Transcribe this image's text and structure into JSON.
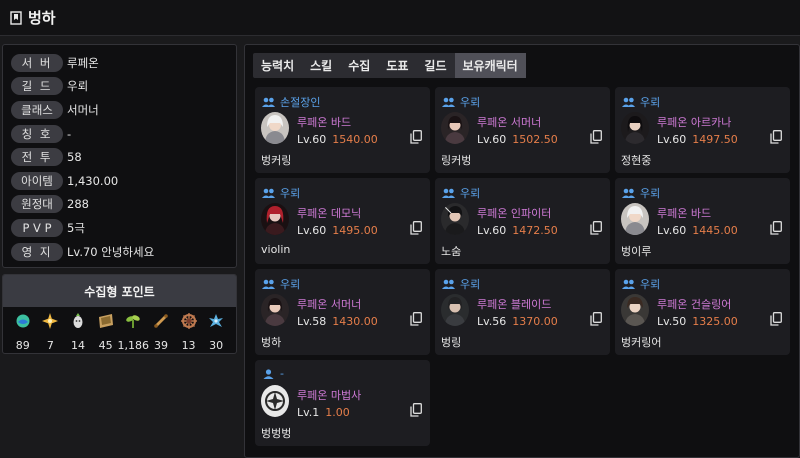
{
  "header": {
    "title": "벙하"
  },
  "info": {
    "rows": [
      {
        "label": "서 버",
        "value": "루페온"
      },
      {
        "label": "길 드",
        "value": "우뢰"
      },
      {
        "label": "클래스",
        "value": "서머너"
      },
      {
        "label": "칭 호",
        "value": "-"
      },
      {
        "label": "전 투",
        "value": "58"
      },
      {
        "label": "아이템",
        "value": "1,430.00"
      },
      {
        "label": "원정대",
        "value": "288"
      },
      {
        "label": "P V P",
        "value": "5극"
      },
      {
        "label": "영 지",
        "value": "Lv.70 안녕하세요"
      }
    ]
  },
  "collection": {
    "title": "수집형 포인트",
    "items": [
      {
        "icon": "island-heart-icon",
        "value": "89"
      },
      {
        "icon": "star-icon",
        "value": "7"
      },
      {
        "icon": "mokoko-seed-icon",
        "value": "14"
      },
      {
        "icon": "painting-icon",
        "value": "45"
      },
      {
        "icon": "sprout-icon",
        "value": "1,186"
      },
      {
        "icon": "adventure-scroll-icon",
        "value": "39"
      },
      {
        "icon": "great-voyage-icon",
        "value": "13"
      },
      {
        "icon": "world-tree-leaf-icon",
        "value": "30"
      }
    ]
  },
  "tabs": [
    "능력치",
    "스킬",
    "수집",
    "도표",
    "길드",
    "보유캐릭터"
  ],
  "active_tab": "보유캐릭터",
  "characters": [
    {
      "guild": "손절장인",
      "class": "루페온 바드",
      "level": "Lv.60",
      "item_level": "1540.00",
      "name": "벙커링",
      "avatar": "bard"
    },
    {
      "guild": "우뢰",
      "class": "루페온 서머너",
      "level": "Lv.60",
      "item_level": "1502.50",
      "name": "링커벙",
      "avatar": "summoner"
    },
    {
      "guild": "우뢰",
      "class": "루페온 아르카나",
      "level": "Lv.60",
      "item_level": "1497.50",
      "name": "정현중",
      "avatar": "arcana"
    },
    {
      "guild": "우뢰",
      "class": "루페온 데모닉",
      "level": "Lv.60",
      "item_level": "1495.00",
      "name": "violin",
      "avatar": "demonic"
    },
    {
      "guild": "우뢰",
      "class": "루페온 인파이터",
      "level": "Lv.60",
      "item_level": "1472.50",
      "name": "노숨",
      "avatar": "infighter"
    },
    {
      "guild": "우뢰",
      "class": "루페온 바드",
      "level": "Lv.60",
      "item_level": "1445.00",
      "name": "벙이루",
      "avatar": "bard"
    },
    {
      "guild": "우뢰",
      "class": "루페온 서머너",
      "level": "Lv.58",
      "item_level": "1430.00",
      "name": "벙하",
      "avatar": "summoner"
    },
    {
      "guild": "우뢰",
      "class": "루페온 블레이드",
      "level": "Lv.56",
      "item_level": "1370.00",
      "name": "벙링",
      "avatar": "blade"
    },
    {
      "guild": "우뢰",
      "class": "루페온 건슬링어",
      "level": "Lv.50",
      "item_level": "1325.00",
      "name": "벙커링어",
      "avatar": "gunslinger"
    },
    {
      "guild": "-",
      "class": "루페온 마법사",
      "level": "Lv.1",
      "item_level": "1.00",
      "name": "벙벙벙",
      "avatar": "mage-emblem"
    }
  ],
  "colors": {
    "guild_text": "#5aa2ea",
    "class_text": "#cf7ad6",
    "item_level": "#e67e4a",
    "active_tab": "#505058"
  }
}
